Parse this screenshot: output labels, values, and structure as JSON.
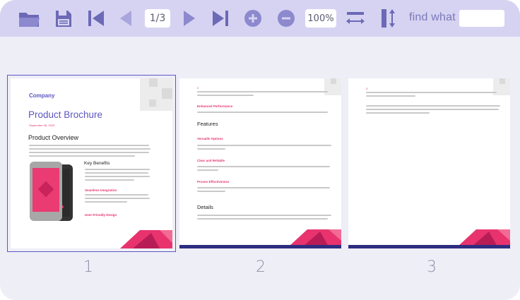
{
  "toolbar": {
    "page_indicator": "1/3",
    "zoom_level": "100%",
    "find_label": "find what",
    "find_value": "",
    "icons": [
      "open-folder-icon",
      "save-icon",
      "first-page-icon",
      "previous-page-icon",
      "next-page-icon",
      "last-page-icon",
      "zoom-in-icon",
      "zoom-out-icon",
      "fit-width-icon",
      "fit-height-icon"
    ]
  },
  "pages": [
    {
      "number": "1",
      "selected": true,
      "company": "Company",
      "title": "Product Brochure",
      "date": "September 06, 2023",
      "overview_heading": "Product Overview",
      "key_benefits": "Key Benefits",
      "seamless": "Seamless Integration",
      "userfriendly": "User-Friendly Design"
    },
    {
      "number": "2",
      "page_label": "2",
      "enhanced": "Enhanced Performance",
      "features": "Features",
      "versatile": "Versatile Options",
      "clear": "Clear and Reliable",
      "proven": "Proven Effectiveness",
      "details": "Details"
    },
    {
      "number": "3",
      "page_label": "3"
    }
  ],
  "colors": {
    "toolbar_bg": "#d6d3f2",
    "icon": "#6c69b7",
    "accent_pink": "#e8336e",
    "accent_purple": "#5c56c4",
    "navy_bar": "#2e2d82"
  }
}
